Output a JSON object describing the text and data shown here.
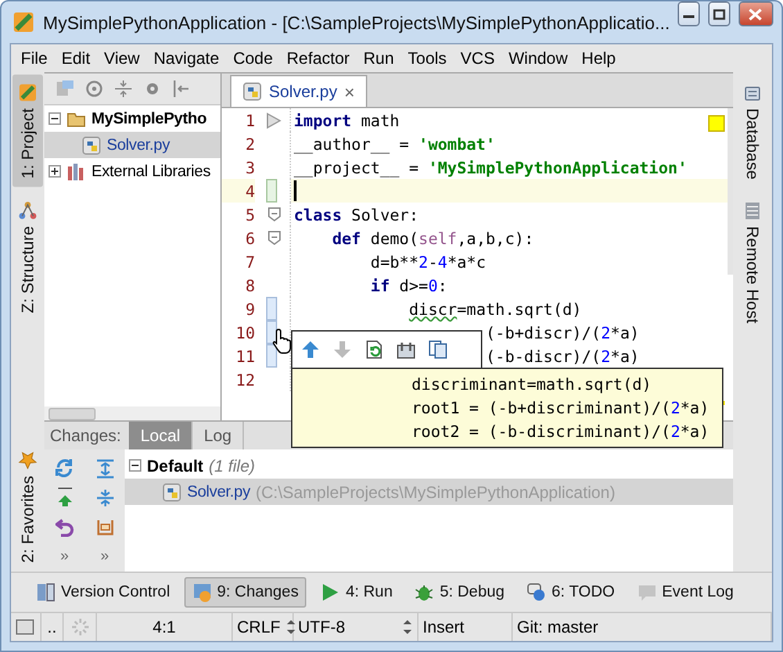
{
  "window": {
    "title": "MySimplePythonApplication - [C:\\SampleProjects\\MySimplePythonApplicatio..."
  },
  "menu": [
    "File",
    "Edit",
    "View",
    "Navigate",
    "Code",
    "Refactor",
    "Run",
    "Tools",
    "VCS",
    "Window",
    "Help"
  ],
  "left_stripe": [
    {
      "label": "1: Project",
      "kind": "project",
      "selected": true
    },
    {
      "label": "Z: Structure",
      "kind": "structure",
      "selected": false
    }
  ],
  "left_stripe_bottom": [
    {
      "label": "2: Favorites",
      "kind": "favorites",
      "selected": false
    }
  ],
  "right_stripe": [
    {
      "label": "Database",
      "kind": "database"
    },
    {
      "label": "Remote Host",
      "kind": "remote"
    }
  ],
  "project_tree": [
    {
      "label": "MySimplePytho",
      "kind": "project",
      "expanded": true,
      "selected": false,
      "children": [
        {
          "label": "Solver.py",
          "kind": "file",
          "selected": true
        }
      ]
    },
    {
      "label": "External Libraries",
      "kind": "library",
      "expanded": false,
      "selected": false
    }
  ],
  "editor": {
    "tabs": [
      {
        "label": "Solver.py",
        "selected": true,
        "close": "×"
      }
    ],
    "lines": [
      {
        "number": "1",
        "collapsed_fold": true,
        "tokens": [
          {
            "kind": "kw",
            "text": "import"
          },
          {
            "kind": "plain",
            "text": " math"
          }
        ]
      },
      {
        "number": "2",
        "tokens": [
          {
            "kind": "plain",
            "text": "__author__ = "
          },
          {
            "kind": "str",
            "text": "'wombat'"
          }
        ]
      },
      {
        "number": "3",
        "tokens": [
          {
            "kind": "plain",
            "text": "__project__ = "
          },
          {
            "kind": "str",
            "text": "'MySimplePythonApplication'"
          }
        ]
      },
      {
        "number": "4",
        "current": true,
        "added": true
      },
      {
        "number": "5",
        "fold": true,
        "tokens": [
          {
            "kind": "kw",
            "text": "class"
          },
          {
            "kind": "plain",
            "text": " Solver:"
          }
        ]
      },
      {
        "number": "6",
        "fold": true,
        "tokens": [
          {
            "kind": "kw",
            "text": "    def"
          },
          {
            "kind": "plain",
            "text": " demo("
          },
          {
            "kind": "self",
            "text": "self"
          },
          {
            "kind": "plain",
            "text": ",a,b,c):"
          }
        ]
      },
      {
        "number": "7",
        "tokens": [
          {
            "kind": "plain",
            "text": "        d=b**"
          },
          {
            "kind": "num",
            "text": "2"
          },
          {
            "kind": "plain",
            "text": "-"
          },
          {
            "kind": "num",
            "text": "4"
          },
          {
            "kind": "plain",
            "text": "*a*c"
          }
        ]
      },
      {
        "number": "8",
        "tokens": [
          {
            "kind": "kw",
            "text": "        if"
          },
          {
            "kind": "plain",
            "text": " d>="
          },
          {
            "kind": "num",
            "text": "0"
          },
          {
            "kind": "plain",
            "text": ":"
          }
        ]
      },
      {
        "number": "9",
        "modified": true,
        "tokens": [
          {
            "kind": "warn",
            "text": "            discr"
          },
          {
            "kind": "plain",
            "text": "=math.sqrt(d)"
          }
        ]
      },
      {
        "number": "10",
        "modified": true,
        "tokens": [
          {
            "kind": "plain",
            "text": "                    (-b+discr)/("
          },
          {
            "kind": "num",
            "text": "2"
          },
          {
            "kind": "plain",
            "text": "*a)"
          }
        ]
      },
      {
        "number": "11",
        "modified": true,
        "tokens": [
          {
            "kind": "plain",
            "text": "                    (-b-discr)/("
          },
          {
            "kind": "num",
            "text": "2"
          },
          {
            "kind": "plain",
            "text": "*a)"
          }
        ]
      },
      {
        "number": "12"
      }
    ],
    "popup": {
      "lines": [
        [
          {
            "kind": "plain",
            "text": "discriminant=math.sqrt(d)"
          }
        ],
        [
          {
            "kind": "plain",
            "text": "root1 = (-b+discriminant)/("
          },
          {
            "kind": "num",
            "text": "2"
          },
          {
            "kind": "plain",
            "text": "*a)"
          }
        ],
        [
          {
            "kind": "plain",
            "text": "root2 = (-b-discriminant)/("
          },
          {
            "kind": "num",
            "text": "2"
          },
          {
            "kind": "plain",
            "text": "*a)"
          }
        ]
      ]
    }
  },
  "changes": {
    "label": "Changes:",
    "tabs": [
      {
        "label": "Local",
        "selected": true
      },
      {
        "label": "Log",
        "selected": false
      }
    ],
    "overflow": [
      "»",
      "»"
    ],
    "tree": [
      {
        "label": "Default",
        "note": "(1 file)",
        "expanded": true,
        "children": [
          {
            "label": "Solver.py",
            "path": "(C:\\SampleProjects\\MySimplePythonApplication)",
            "selected": true
          }
        ]
      }
    ]
  },
  "tool_windows": [
    {
      "label": "Version Control",
      "kind": "vcs",
      "selected": false
    },
    {
      "label": "9: Changes",
      "kind": "changes",
      "selected": true
    },
    {
      "label": "4: Run",
      "kind": "run",
      "selected": false
    },
    {
      "label": "5: Debug",
      "kind": "debug",
      "selected": false
    },
    {
      "label": "6: TODO",
      "kind": "todo",
      "selected": false
    },
    {
      "label": "Event Log",
      "kind": "log",
      "selected": false
    }
  ],
  "status_bar": {
    "more": "..",
    "position": "4:1",
    "line_separator": "CRLF",
    "encoding": "UTF-8",
    "mode": "Insert",
    "branch": "Git: master"
  }
}
